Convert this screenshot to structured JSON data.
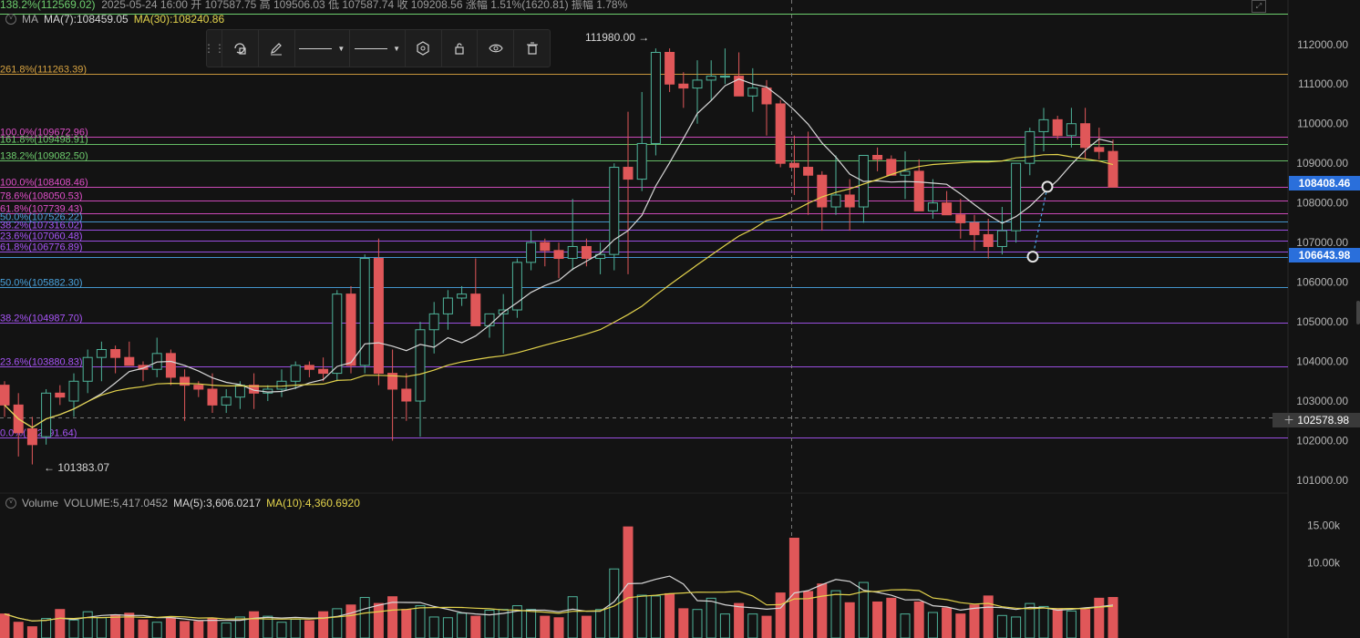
{
  "header": {
    "fib_top_left": "138.2%(112569.02)",
    "ohlc_line": "2025-05-24 16:00  开 107587.75  高 109506.03  低 107587.74  收 109208.56  涨幅 1.51%(1620.81)  振幅 1.78%"
  },
  "ma_row": {
    "chevron": "˅",
    "label": "MA",
    "ma7": "MA(7):108459.05",
    "ma30": "MA(30):108240.86"
  },
  "volume_row": {
    "chevron": "˅",
    "label": "Volume",
    "vol": "VOLUME:5,417.0452",
    "ma5": "MA(5):3,606.0217",
    "ma10": "MA(10):4,360.6920"
  },
  "toolbar": {
    "drag_icon": "⋮⋮",
    "icons": [
      "object-tree-icon",
      "pen-icon",
      "line-style-dropdown",
      "line-width-dropdown",
      "settings-icon",
      "lock-icon",
      "visibility-icon",
      "trash-icon"
    ]
  },
  "fib_levels": [
    {
      "label": "261.8%(111263.39)",
      "price": 111263.39,
      "color": "#d9a441"
    },
    {
      "label": "100.0%(109672.96)",
      "price": 109672.96,
      "color": "#e04fc9"
    },
    {
      "label": "161.8%(109498.91)",
      "price": 109498.91,
      "color": "#6ecf6e"
    },
    {
      "label": "138.2%(109082.50)",
      "price": 109082.5,
      "color": "#6ecf6e"
    },
    {
      "label": "100.0%(108408.46)",
      "price": 108408.46,
      "color": "#e04fc9"
    },
    {
      "label": "78.6%(108050.53)",
      "price": 108050.53,
      "color": "#e04fc9"
    },
    {
      "label": "61.8%(107739.43)",
      "price": 107739.43,
      "color": "#e04fc9"
    },
    {
      "label": "50.0%(107526.22)",
      "price": 107526.22,
      "color": "#4aa3df"
    },
    {
      "label": "38.2%(107316.02)",
      "price": 107316.02,
      "color": "#a855f7"
    },
    {
      "label": "23.6%(107060.48)",
      "price": 107060.48,
      "color": "#a855f7"
    },
    {
      "label": "61.8%(106776.89)",
      "price": 106776.89,
      "color": "#a855f7"
    },
    {
      "label": "",
      "price": 106643.98,
      "color": "#4aa3df"
    },
    {
      "label": "50.0%(105882.30)",
      "price": 105882.3,
      "color": "#4aa3df"
    },
    {
      "label": "38.2%(104987.70)",
      "price": 104987.7,
      "color": "#a855f7"
    },
    {
      "label": "23.6%(103880.83)",
      "price": 103880.83,
      "color": "#a855f7"
    },
    {
      "label": "0.0%(102091.64)",
      "price": 102091.64,
      "color": "#a855f7"
    }
  ],
  "annotations": {
    "high": "111980.00 →",
    "low": "← 101383.07"
  },
  "price_axis": {
    "ticks": [
      "112000.00",
      "111000.00",
      "110000.00",
      "109000.00",
      "108000.00",
      "107000.00",
      "106000.00",
      "105000.00",
      "104000.00",
      "103000.00",
      "102000.00",
      "101000.00"
    ],
    "marker1": "108408.46",
    "marker2": "106643.98",
    "crosshair_price": "102578.98"
  },
  "volume_axis": {
    "ticks": [
      "15.00k",
      "10.00k"
    ]
  },
  "colors": {
    "up": "#4fb39a",
    "down": "#e05759",
    "ma7": "#d7d7d7",
    "ma30": "#e3d34c",
    "accent": "#2a6fdb"
  },
  "chart_data": {
    "type": "candlestick",
    "price_range": [
      100700,
      112800
    ],
    "volume_range": [
      0,
      17000
    ],
    "candles": [
      [
        103400,
        103500,
        102600,
        102900,
        3200
      ],
      [
        102900,
        103200,
        101600,
        102200,
        2100
      ],
      [
        102300,
        102600,
        101400,
        101900,
        1500
      ],
      [
        102100,
        103300,
        101900,
        103200,
        2600
      ],
      [
        103200,
        103400,
        102900,
        103100,
        3800
      ],
      [
        103000,
        103700,
        102600,
        103500,
        2400
      ],
      [
        103500,
        104300,
        103200,
        104100,
        3500
      ],
      [
        104100,
        104500,
        103500,
        104300,
        2700
      ],
      [
        104300,
        104400,
        103700,
        104100,
        3100
      ],
      [
        104100,
        104500,
        103900,
        103900,
        3300
      ],
      [
        103900,
        104000,
        103500,
        103800,
        2400
      ],
      [
        103800,
        104600,
        103600,
        104200,
        2100
      ],
      [
        104200,
        104300,
        103400,
        103600,
        2700
      ],
      [
        103600,
        103800,
        102500,
        103400,
        2200
      ],
      [
        103400,
        103500,
        103100,
        103300,
        2200
      ],
      [
        103300,
        103700,
        102700,
        102900,
        2600
      ],
      [
        102900,
        103300,
        102700,
        103100,
        2000
      ],
      [
        103100,
        103500,
        102800,
        103400,
        2800
      ],
      [
        103400,
        103700,
        102800,
        103200,
        3500
      ],
      [
        103200,
        103400,
        103000,
        103300,
        2900
      ],
      [
        103300,
        103800,
        103100,
        103500,
        2100
      ],
      [
        103500,
        104000,
        103300,
        103900,
        2500
      ],
      [
        103900,
        104000,
        103600,
        103800,
        2300
      ],
      [
        103800,
        104100,
        103500,
        103700,
        3500
      ],
      [
        103700,
        105800,
        103500,
        105700,
        3900
      ],
      [
        105700,
        105900,
        103700,
        103900,
        4400
      ],
      [
        103900,
        106700,
        103700,
        106600,
        5400
      ],
      [
        106600,
        107100,
        103400,
        103700,
        4600
      ],
      [
        103700,
        104300,
        102000,
        103300,
        5500
      ],
      [
        103300,
        103700,
        102500,
        103000,
        3800
      ],
      [
        103000,
        105000,
        102100,
        104800,
        4300
      ],
      [
        104800,
        105500,
        104200,
        105200,
        2800
      ],
      [
        105200,
        105800,
        104800,
        105600,
        2700
      ],
      [
        105600,
        105900,
        105400,
        105700,
        3300
      ],
      [
        105700,
        106600,
        104900,
        104900,
        2900
      ],
      [
        104900,
        105000,
        104600,
        105200,
        3700
      ],
      [
        105200,
        105700,
        104200,
        105300,
        3800
      ],
      [
        105300,
        106600,
        105100,
        106500,
        4300
      ],
      [
        106500,
        107300,
        106300,
        107000,
        3800
      ],
      [
        107000,
        107100,
        106400,
        106800,
        2900
      ],
      [
        106800,
        107000,
        106100,
        106600,
        2700
      ],
      [
        106600,
        108100,
        106300,
        106900,
        5500
      ],
      [
        106900,
        107100,
        106400,
        106600,
        2900
      ],
      [
        106600,
        107000,
        106200,
        106700,
        3800
      ],
      [
        106700,
        109000,
        106300,
        108900,
        9200
      ],
      [
        108900,
        110300,
        106200,
        108600,
        14800
      ],
      [
        108600,
        110800,
        108300,
        109500,
        5700
      ],
      [
        109500,
        111900,
        109200,
        111800,
        5600
      ],
      [
        111800,
        111900,
        110800,
        111000,
        5900
      ],
      [
        111000,
        111300,
        110400,
        110900,
        3900
      ],
      [
        110900,
        111600,
        110000,
        111100,
        3800
      ],
      [
        111100,
        111600,
        110600,
        111200,
        5300
      ],
      [
        111200,
        111900,
        111000,
        111200,
        3200
      ],
      [
        111200,
        111800,
        110700,
        110700,
        4600
      ],
      [
        110700,
        111400,
        110300,
        110900,
        3200
      ],
      [
        110900,
        111100,
        109700,
        110500,
        2900
      ],
      [
        110500,
        110600,
        108900,
        109000,
        6000
      ],
      [
        109000,
        109700,
        108200,
        108900,
        13300
      ],
      [
        108900,
        109800,
        107700,
        108700,
        6200
      ],
      [
        108700,
        108800,
        107300,
        107900,
        7200
      ],
      [
        107900,
        109200,
        107700,
        108200,
        6300
      ],
      [
        108200,
        108600,
        107300,
        107900,
        4700
      ],
      [
        107900,
        109200,
        107500,
        109200,
        7400
      ],
      [
        109200,
        109400,
        108800,
        109100,
        4800
      ],
      [
        109100,
        109200,
        108800,
        108700,
        5300
      ],
      [
        108700,
        109300,
        108100,
        108800,
        3200
      ],
      [
        108800,
        109100,
        108100,
        107800,
        4800
      ],
      [
        107800,
        108600,
        107600,
        108000,
        3400
      ],
      [
        108000,
        108300,
        107700,
        107700,
        4000
      ],
      [
        107700,
        108100,
        107100,
        107500,
        3200
      ],
      [
        107500,
        107700,
        106800,
        107200,
        4400
      ],
      [
        107200,
        107600,
        106600,
        106900,
        5600
      ],
      [
        106900,
        107900,
        106700,
        107300,
        3000
      ],
      [
        107300,
        109000,
        107000,
        109000,
        2800
      ],
      [
        109000,
        109900,
        108700,
        109800,
        4600
      ],
      [
        109800,
        110400,
        109300,
        110100,
        4200
      ],
      [
        110100,
        110200,
        109600,
        109700,
        3900
      ],
      [
        109700,
        110400,
        109400,
        110000,
        3600
      ],
      [
        110000,
        110400,
        109100,
        109400,
        3800
      ],
      [
        109400,
        109900,
        109100,
        109300,
        5300
      ],
      [
        109300,
        109600,
        108600,
        108400,
        5400
      ]
    ],
    "ma7_note": "computed in script",
    "drawing": {
      "from_price": 108408.46,
      "to_price": 106643.98
    }
  }
}
